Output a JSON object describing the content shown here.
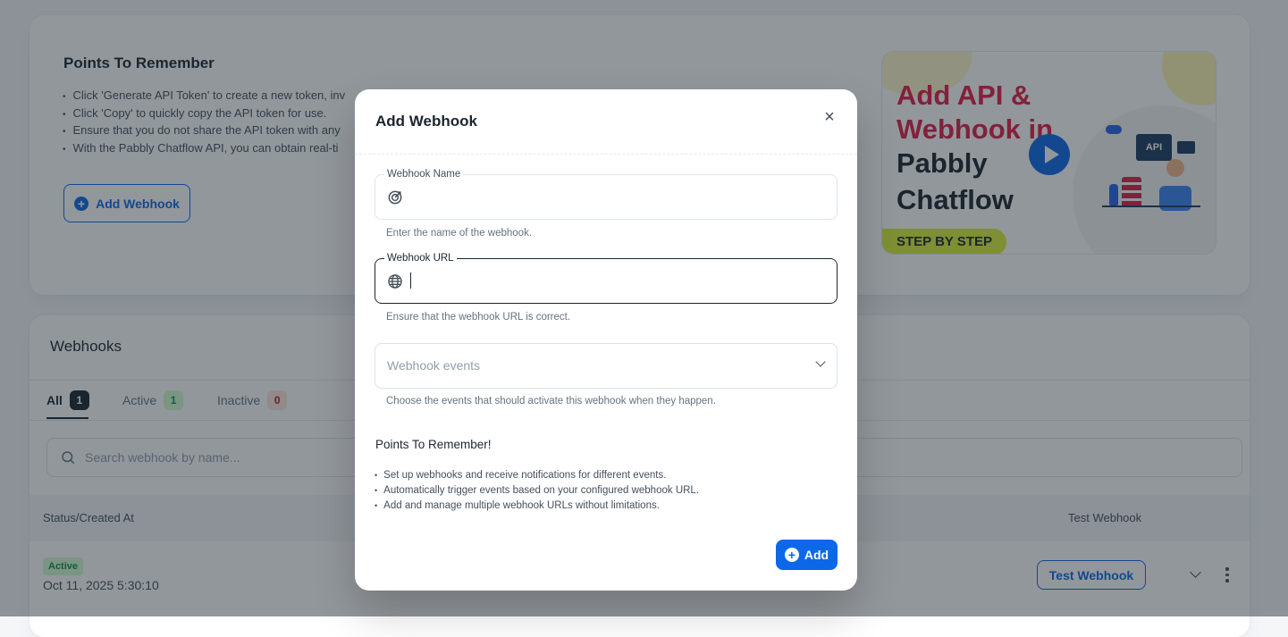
{
  "background": {
    "points_card": {
      "title": "Points To Remember",
      "items": [
        "Click 'Generate API Token' to create a new token, inv",
        "Click 'Copy' to quickly copy the API token for use.",
        "Ensure that you do not share the API token with any",
        "With the Pabbly Chatflow API, you can obtain real-ti"
      ],
      "add_button_label": "Add Webhook"
    },
    "thumbnail": {
      "line1": "Add API &",
      "line2": "Webhook in",
      "line3": "Pabbly",
      "line4": "Chatflow",
      "step_label": "STEP BY STEP",
      "monitor_label": "API"
    },
    "webhooks_card": {
      "title": "Webhooks",
      "tabs": [
        {
          "label": "All",
          "count": "1"
        },
        {
          "label": "Active",
          "count": "1"
        },
        {
          "label": "Inactive",
          "count": "0"
        }
      ],
      "search_placeholder": "Search webhook by name...",
      "columns": {
        "status": "Status/Created At",
        "test": "Test Webhook"
      },
      "row": {
        "status": "Active",
        "created_at": "Oct 11, 2025 5:30:10",
        "test_button_label": "Test Webhook"
      }
    }
  },
  "modal": {
    "title": "Add Webhook",
    "close_icon": "×",
    "webhook_name": {
      "label": "Webhook Name",
      "value": "",
      "helper": "Enter the name of the webhook."
    },
    "webhook_url": {
      "label": "Webhook URL",
      "value": "",
      "helper": "Ensure that the webhook URL is correct."
    },
    "webhook_events": {
      "placeholder": "Webhook events",
      "helper": "Choose the events that should activate this webhook when they happen."
    },
    "points_title": "Points To Remember!",
    "points": [
      "Set up webhooks and receive notifications for different events.",
      "Automatically trigger events based on your configured webhook URL.",
      "Add and manage multiple webhook URLs without limitations."
    ],
    "add_button_label": "Add"
  },
  "colors": {
    "primary": "#0c68e9",
    "overlay": "rgba(28,37,46,0.48)",
    "active_badge_bg": "#d3fcd2",
    "inactive_badge_bg": "#ffe4de"
  }
}
